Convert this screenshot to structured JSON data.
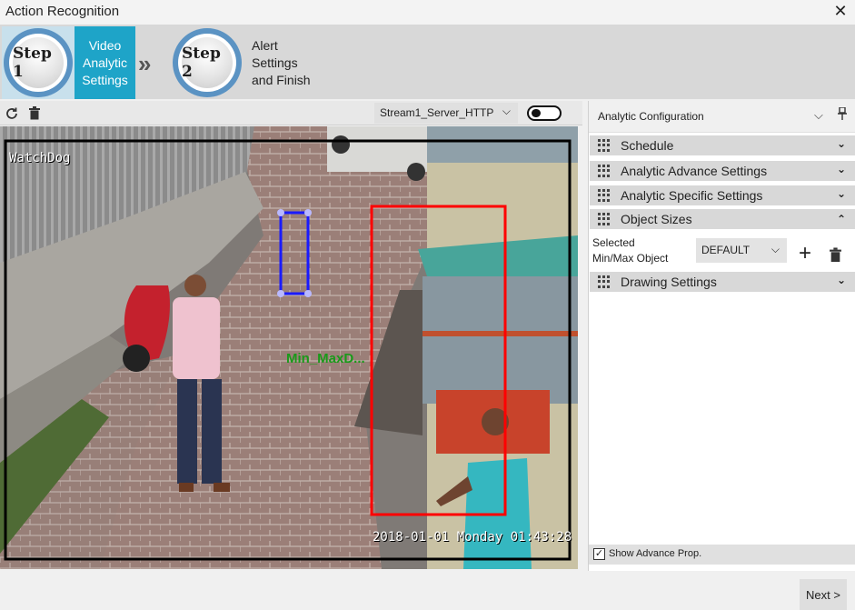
{
  "window": {
    "title": "Action Recognition"
  },
  "wizard": {
    "step1": {
      "badge": "Step 1",
      "label_lines": [
        "Video",
        "Analytic",
        "Settings"
      ]
    },
    "step2": {
      "badge": "Step 2",
      "label_lines": [
        "Alert",
        "Settings",
        "and Finish"
      ]
    }
  },
  "video_toolbar": {
    "stream": "Stream1_Server_HTTP",
    "toggle_on": false
  },
  "video": {
    "watermark": "WatchDog",
    "timestamp": "2018-01-01 Monday 01:43:28",
    "object_label": "Min_MaxD..."
  },
  "config_panel": {
    "title": "Analytic Configuration",
    "sections": {
      "schedule": "Schedule",
      "advance": "Analytic Advance Settings",
      "specific": "Analytic Specific Settings",
      "object_sizes": "Object Sizes",
      "drawing": "Drawing Settings"
    },
    "selected_label_lines": [
      "Selected",
      "Min/Max Object"
    ],
    "selected_value": "DEFAULT",
    "show_advance": "Show Advance Prop.",
    "show_advance_checked": true
  },
  "footer": {
    "next": "Next >"
  },
  "colors": {
    "accent": "#1ea4c8",
    "region_red": "#ff0000",
    "region_blue": "#1a1aff",
    "label_green": "#1a9a1a"
  }
}
